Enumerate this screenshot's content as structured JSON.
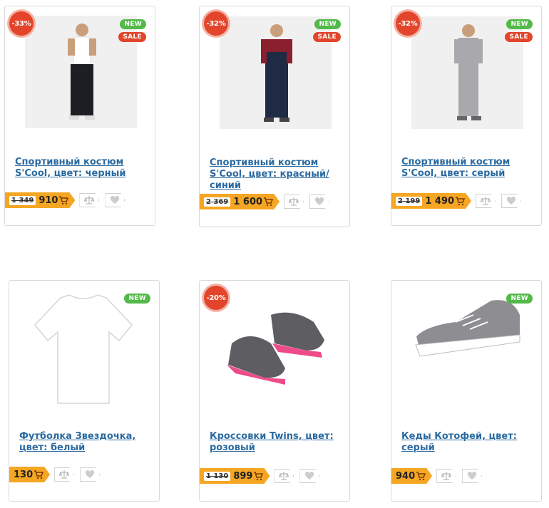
{
  "products": [
    {
      "title": "Спортивный костюм S'Cool, цвет: черный",
      "discount": "-33%",
      "badges": [
        "NEW",
        "SALE"
      ],
      "old_price": "1 349",
      "price": "910",
      "image": "boy-white-tshirt-black-pants"
    },
    {
      "title": "Спортивный костюм S'Cool, цвет: красный/синий",
      "discount": "-32%",
      "badges": [
        "NEW",
        "SALE"
      ],
      "old_price": "2 369",
      "price": "1 600",
      "image": "boy-red-navy-tracksuit"
    },
    {
      "title": "Спортивный костюм S'Cool, цвет: серый",
      "discount": "-32%",
      "badges": [
        "NEW",
        "SALE"
      ],
      "old_price": "2 199",
      "price": "1 490",
      "image": "girl-grey-tracksuit"
    },
    {
      "title": "Футболка Звездочка, цвет: белый",
      "discount": "",
      "badges": [
        "NEW"
      ],
      "old_price": "",
      "price": "130",
      "image": "white-tshirt"
    },
    {
      "title": "Кроссовки Twins, цвет: розовый",
      "discount": "-20%",
      "badges": [],
      "old_price": "1 130",
      "price": "899",
      "image": "pink-grey-sneakers"
    },
    {
      "title": "Кеды Котофей, цвет: серый",
      "discount": "",
      "badges": [
        "NEW"
      ],
      "old_price": "",
      "price": "940",
      "image": "grey-canvas-shoe"
    }
  ],
  "icons": {
    "cart": "cart-icon",
    "compare": "scales-icon",
    "wishlist": "heart-icon"
  },
  "colors": {
    "accent": "#f5a623",
    "link": "#2b6aa0",
    "sale": "#e2452b",
    "new": "#53b948"
  }
}
